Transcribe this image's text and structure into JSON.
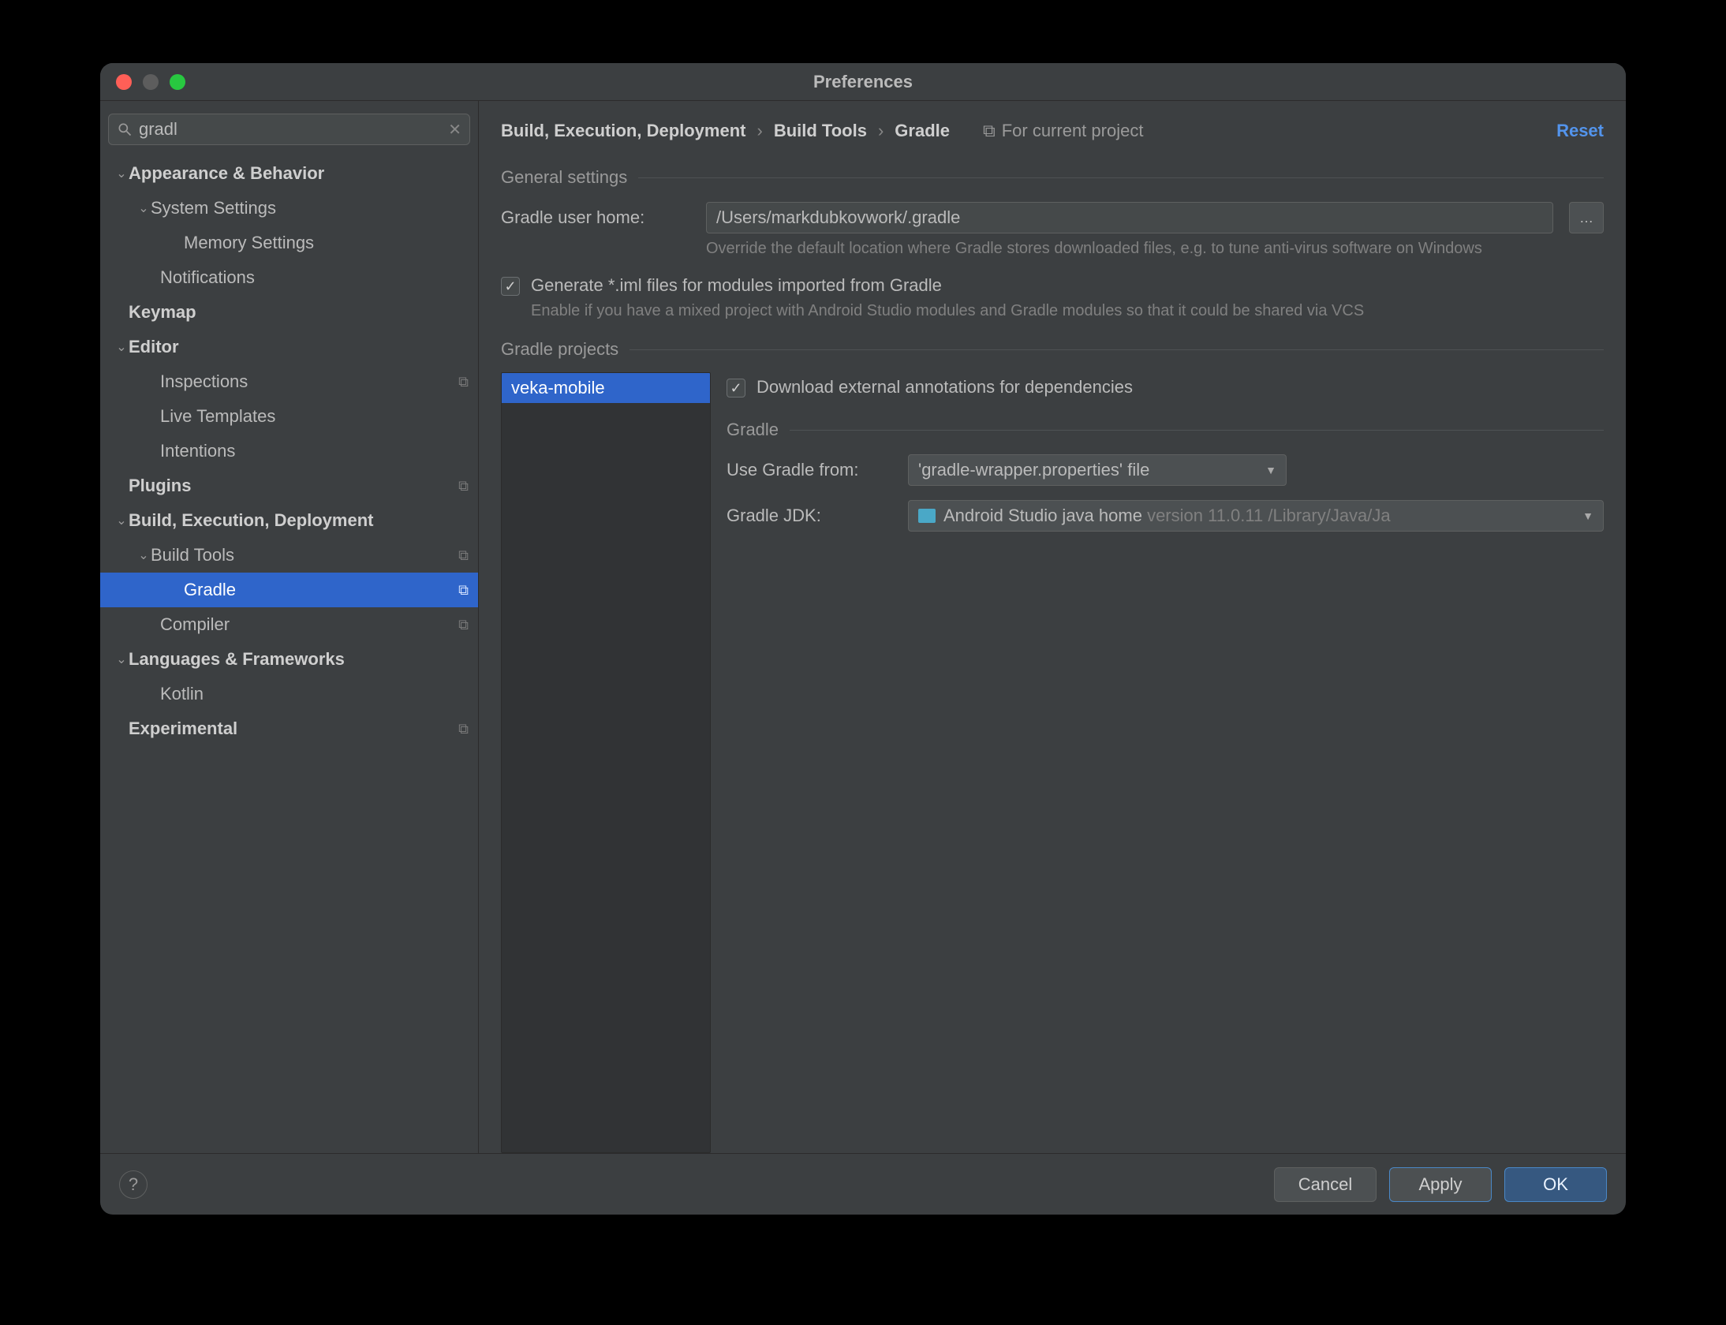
{
  "window": {
    "title": "Preferences"
  },
  "search": {
    "value": "gradl"
  },
  "sidebar": {
    "items": [
      {
        "label": "Appearance & Behavior"
      },
      {
        "label": "System Settings"
      },
      {
        "label": "Memory Settings"
      },
      {
        "label": "Notifications"
      },
      {
        "label": "Keymap"
      },
      {
        "label": "Editor"
      },
      {
        "label": "Inspections"
      },
      {
        "label": "Live Templates"
      },
      {
        "label": "Intentions"
      },
      {
        "label": "Plugins"
      },
      {
        "label": "Build, Execution, Deployment"
      },
      {
        "label": "Build Tools"
      },
      {
        "label": "Gradle"
      },
      {
        "label": "Compiler"
      },
      {
        "label": "Languages & Frameworks"
      },
      {
        "label": "Kotlin"
      },
      {
        "label": "Experimental"
      }
    ]
  },
  "breadcrumb": {
    "a": "Build, Execution, Deployment",
    "b": "Build Tools",
    "c": "Gradle",
    "scope": "For current project",
    "reset": "Reset"
  },
  "general": {
    "title": "General settings",
    "home_label": "Gradle user home:",
    "home_value": "/Users/markdubkovwork/.gradle",
    "home_hint": "Override the default location where Gradle stores downloaded files, e.g. to tune anti-virus software on Windows",
    "iml_label": "Generate *.iml files for modules imported from Gradle",
    "iml_hint": "Enable if you have a mixed project with Android Studio modules and Gradle modules so that it could be shared via VCS"
  },
  "projects": {
    "title": "Gradle projects",
    "list": [
      "veka-mobile"
    ],
    "download_label": "Download external annotations for dependencies",
    "section": "Gradle",
    "use_from_label": "Use Gradle from:",
    "use_from_value": "'gradle-wrapper.properties' file",
    "jdk_label": "Gradle JDK:",
    "jdk_value": "Android Studio java home",
    "jdk_detail": "version 11.0.11 /Library/Java/Ja"
  },
  "footer": {
    "cancel": "Cancel",
    "apply": "Apply",
    "ok": "OK"
  }
}
